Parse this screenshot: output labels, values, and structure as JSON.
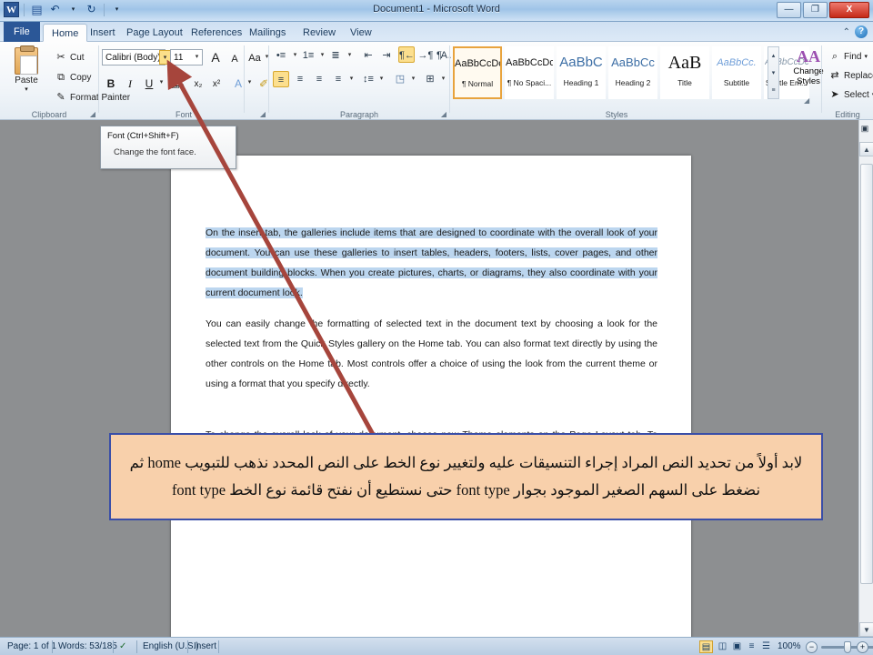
{
  "window": {
    "title": "Document1 - Microsoft Word",
    "quick_access": [
      {
        "name": "word-logo",
        "glyph": "W"
      },
      {
        "name": "save-icon",
        "glyph": "▤"
      },
      {
        "name": "undo-icon",
        "glyph": "↶"
      },
      {
        "name": "undo-dropdown-icon",
        "glyph": "▾"
      },
      {
        "name": "redo-icon",
        "glyph": "↻"
      },
      {
        "name": "customize-qat-icon",
        "glyph": "▾"
      }
    ],
    "controls": {
      "minimize": "—",
      "restore": "❐",
      "close": "X"
    },
    "help": {
      "collapse": "⌃",
      "help_label": "?"
    }
  },
  "tabs": [
    {
      "label": "File",
      "active": false,
      "file": true
    },
    {
      "label": "Home",
      "active": true
    },
    {
      "label": "Insert",
      "active": false
    },
    {
      "label": "Page Layout",
      "active": false
    },
    {
      "label": "References",
      "active": false
    },
    {
      "label": "Mailings",
      "active": false
    },
    {
      "label": "Review",
      "active": false
    },
    {
      "label": "View",
      "active": false
    }
  ],
  "ribbon": {
    "groups": [
      {
        "name": "clipboard",
        "label": "Clipboard"
      },
      {
        "name": "font",
        "label": "Font"
      },
      {
        "name": "paragraph",
        "label": "Paragraph"
      },
      {
        "name": "styles",
        "label": "Styles"
      },
      {
        "name": "editing",
        "label": "Editing"
      }
    ],
    "clipboard": {
      "paste_label": "Paste",
      "paste_dropdown": "▾",
      "cut_label": "Cut",
      "copy_label": "Copy",
      "format_painter_label": "Format Painter",
      "cut_icon": "✂",
      "copy_icon": "⧉",
      "format_painter_icon": "✎"
    },
    "font": {
      "font_name": "Calibri (Body)",
      "font_name_dropdown": "▾",
      "font_size": "11",
      "font_size_dropdown": "▾",
      "grow_font": "A",
      "shrink_font": "A",
      "change_case": "Aa",
      "change_case_dropdown": "▾",
      "clear_formatting": "⌧",
      "bold": "B",
      "italic": "I",
      "underline": "U",
      "underline_dropdown": "▾",
      "strikethrough": "abc",
      "subscript": "x₂",
      "superscript": "x²",
      "text_effects": "A",
      "text_effects_dropdown": "▾",
      "highlight": "✐",
      "highlight_dropdown": "▾",
      "font_color": "A",
      "font_color_dropdown": "▾",
      "dropdown_highlighted": true
    },
    "paragraph": {
      "bullets": "•≡",
      "numbering": "1≡",
      "multilevel": "≣",
      "decrease_indent": "⇤",
      "increase_indent": "⇥",
      "rtl_direction": "¶←",
      "ltr_direction": "→¶",
      "sort": "A↓",
      "show_marks": "¶",
      "align_left": "≡",
      "align_center": "≡",
      "align_right": "≡",
      "justify": "≡",
      "justify_dropdown": "▾",
      "line_spacing": "↕≡",
      "line_spacing_dropdown": "▾",
      "shading": "◳",
      "shading_dropdown": "▾",
      "borders": "⊞",
      "borders_dropdown": "▾"
    },
    "styles": {
      "items": [
        {
          "preview": "AaBbCcDc",
          "name": "¶ Normal",
          "selected": true
        },
        {
          "preview": "AaBbCcDc",
          "name": "¶ No Spaci...",
          "selected": false
        },
        {
          "preview": "AaBbC",
          "name": "Heading 1",
          "selected": false
        },
        {
          "preview": "AaBbCc",
          "name": "Heading 2",
          "selected": false
        },
        {
          "preview": "AaB",
          "name": "Title",
          "selected": false
        },
        {
          "preview": "AaBbCc.",
          "name": "Subtitle",
          "selected": false
        },
        {
          "preview": "AaBbCcDc",
          "name": "Subtle Em...",
          "selected": false
        }
      ],
      "scroll_up": "▴",
      "scroll_down": "▾",
      "more": "≡"
    },
    "change_styles": {
      "label_line1": "Change",
      "label_line2": "Styles",
      "dropdown": "▾",
      "icon": "AA"
    },
    "editing": {
      "find_label": "Find",
      "find_dropdown": "▾",
      "replace_label": "Replace",
      "select_label": "Select",
      "select_dropdown": "▾",
      "find_icon": "⌕",
      "replace_icon": "⇄",
      "select_icon": "➤"
    }
  },
  "tooltip": {
    "title": "Font (Ctrl+Shift+F)",
    "body": "Change the font face."
  },
  "document": {
    "paragraphs": [
      {
        "selected": true,
        "text": "On the insert tab, the galleries include items that are designed to coordinate with the overall look of your document. You can use these galleries to insert tables, headers, footers, lists, cover pages, and other document building blocks. When you create pictures, charts, or diagrams, they also coordinate with your current document look."
      },
      {
        "selected": false,
        "text": "You can easily change the formatting of selected text in the document text by choosing a look for the selected text from the Quick Styles gallery on the Home tab. You can also format text directly by using the other controls on the Home tab. Most controls offer a choice of using the look from the current theme or using a format that you specify directly."
      },
      {
        "selected": false,
        "text": "To change the overall look of your document, choose new Theme elements on the Page Layout tab. To change the looks available in the Quick Style gallery, use the Change Current Quick Style Set command."
      }
    ]
  },
  "annotation": {
    "text": "لابد أولاً من تحديد النص المراد إجراء التنسيقات عليه ولتغيير نوع الخط على النص المحدد نذهب للتبويب home ثم نضغط على السهم الصغير الموجود بجوار font type حتى نستطيع أن نفتح قائمة نوع الخط font type",
    "border_color": "#3a4ea8",
    "fill_color": "#f8d0ab",
    "arrow_color": "#a6453c"
  },
  "statusbar": {
    "page": "Page: 1 of 1",
    "words": "Words: 53/185",
    "proofing_icon": "✓",
    "language": "English (U.S.)",
    "insert_mode": "Insert",
    "views": [
      {
        "name": "print-layout",
        "glyph": "▤",
        "selected": true
      },
      {
        "name": "full-screen-reading",
        "glyph": "◫",
        "selected": false
      },
      {
        "name": "web-layout",
        "glyph": "▣",
        "selected": false
      },
      {
        "name": "outline",
        "glyph": "≡",
        "selected": false
      },
      {
        "name": "draft",
        "glyph": "☰",
        "selected": false
      }
    ],
    "zoom_level": "100%",
    "zoom_out": "−",
    "zoom_in": "+"
  }
}
